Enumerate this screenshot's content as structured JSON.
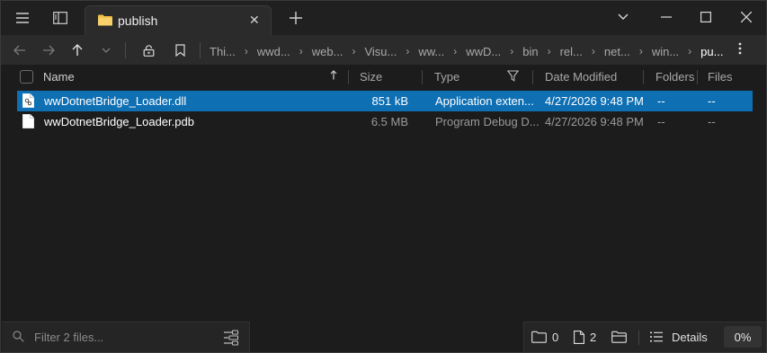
{
  "tab": {
    "title": "publish"
  },
  "breadcrumb": [
    "Thi...",
    "wwd...",
    "web...",
    "Visu...",
    "ww...",
    "wwD...",
    "bin",
    "rel...",
    "net...",
    "win...",
    "pu..."
  ],
  "columns": {
    "name": "Name",
    "size": "Size",
    "type": "Type",
    "date": "Date Modified",
    "folders": "Folders",
    "files": "Files"
  },
  "files": [
    {
      "name": "wwDotnetBridge_Loader.dll",
      "size": "851 kB",
      "type": "Application exten...",
      "date": "4/27/2026  9:48 PM",
      "folders": "--",
      "files": "--",
      "selected": true,
      "icon": "dll-file-icon"
    },
    {
      "name": "wwDotnetBridge_Loader.pdb",
      "size": "6.5 MB",
      "type": "Program Debug D...",
      "date": "4/27/2026  9:48 PM",
      "folders": "--",
      "files": "--",
      "selected": false,
      "icon": "file-icon"
    }
  ],
  "filter": {
    "placeholder": "Filter 2 files..."
  },
  "status": {
    "folders_count": "0",
    "files_count": "2",
    "view_label": "Details",
    "zoom": "0%"
  },
  "colors": {
    "accent": "#0e6fb3",
    "background": "#1c1c1c",
    "folder": "#f3c04a"
  }
}
